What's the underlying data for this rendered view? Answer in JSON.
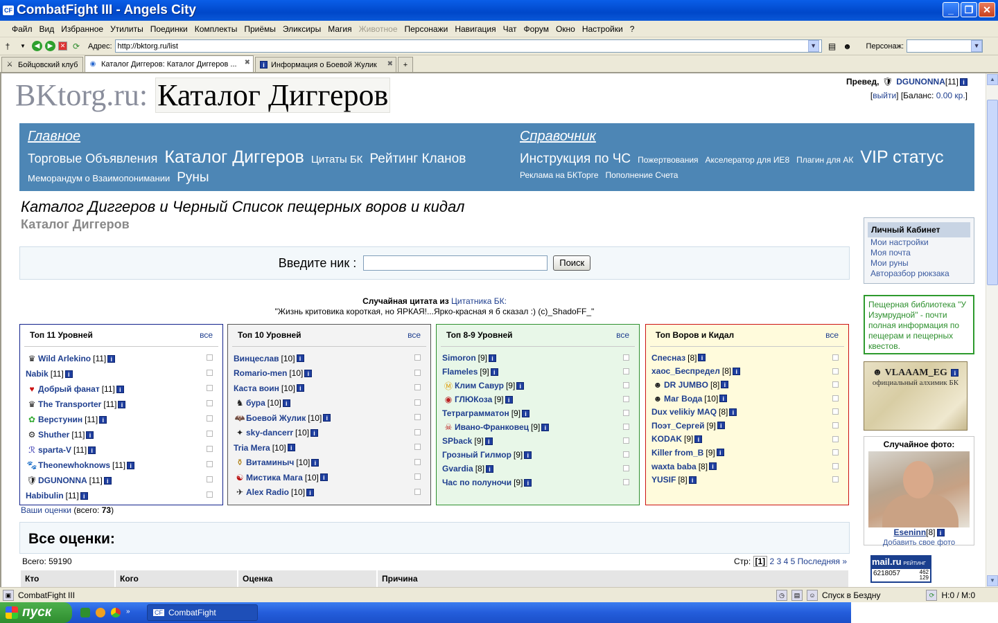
{
  "window": {
    "title": "CombatFight III - Angels City",
    "app_icon": "CF"
  },
  "menu": [
    "Файл",
    "Вид",
    "Избранное",
    "Утилиты",
    "Поединки",
    "Комплекты",
    "Приёмы",
    "Эликсиры",
    "Магия",
    "Животное",
    "Персонажи",
    "Навигация",
    "Чат",
    "Форум",
    "Окно",
    "Настройки",
    "?"
  ],
  "menu_disabled": [
    "Животное"
  ],
  "address": {
    "label": "Адрес:",
    "url": "http://bktorg.ru/list",
    "persona_label": "Персонаж:"
  },
  "tabs": [
    {
      "label": "Бойцовский клуб",
      "icon": "crossed-swords-icon"
    },
    {
      "label": "Каталог Диггеров: Каталог Диггеров ...",
      "icon": "globe-icon"
    },
    {
      "label": "Информация о Боевой Жулик",
      "icon": "info-icon"
    }
  ],
  "site": {
    "logo_left": "BKtorg.ru:",
    "logo_right": "Каталог Диггеров",
    "greeting": "Превед,",
    "user": "DGUNONNA",
    "user_level": "[11]",
    "logout": "выйти",
    "balance_label": "Баланс:",
    "balance": "0.00 кр."
  },
  "nav": {
    "main_head": "Главное",
    "main_row1": [
      "Торговые Объявления",
      "Каталог Диггеров",
      "Цитаты БК",
      "Рейтинг Кланов"
    ],
    "main_row2": [
      "Меморандум о Взаимопонимании",
      "Руны"
    ],
    "ref_head": "Справочник",
    "ref_row1": [
      "Инструкция по ЧС",
      "Пожертвования",
      "Акселератор для ИЕ8",
      "Плагин для АК",
      "VIP статус"
    ],
    "ref_row2": [
      "Реклама на БКТорге",
      "Пополнение Счета"
    ]
  },
  "page": {
    "heading": "Каталог Диггеров и Черный Список пещерных воров и кидал",
    "subheading": "Каталог Диггеров",
    "search_label": "Введите ник :",
    "search_button": "Поиск",
    "quote_title": "Случайная цитата из",
    "quote_source": "Цитатника БК:",
    "quote_text": "\"Жизнь критовика короткая, но ЯРКАЯ!...Ярко-красная я б сказал :) (c)_ShadoFF_\""
  },
  "top_lists": [
    {
      "title": "Топ 11 Уровней",
      "all": "все",
      "items": [
        {
          "name": "Wild Arlekino",
          "level": "[11]",
          "icon": "crown-icon"
        },
        {
          "name": "Nabik",
          "level": "[11]",
          "icon": ""
        },
        {
          "name": "Добрый фанат",
          "level": "[11]",
          "icon": "heart-shield-icon"
        },
        {
          "name": "The Transporter",
          "level": "[11]",
          "icon": "crown-icon"
        },
        {
          "name": "Верстунин",
          "level": "[11]",
          "icon": "leaf-icon"
        },
        {
          "name": "Shuther",
          "level": "[11]",
          "icon": "gear-icon"
        },
        {
          "name": "sparta-V",
          "level": "[11]",
          "icon": "rune-icon"
        },
        {
          "name": "Theonewhoknows",
          "level": "[11]",
          "icon": "panther-icon"
        },
        {
          "name": "DGUNONNA",
          "level": "[11]",
          "icon": "clan-icon"
        },
        {
          "name": "Habibulin",
          "level": "[11]",
          "icon": ""
        }
      ]
    },
    {
      "title": "Топ 10 Уровней",
      "all": "все",
      "items": [
        {
          "name": "Винцеслав",
          "level": "[10]",
          "icon": ""
        },
        {
          "name": "Romario-men",
          "level": "[10]",
          "icon": ""
        },
        {
          "name": "Каста воин",
          "level": "[10]",
          "icon": ""
        },
        {
          "name": "бура",
          "level": "[10]",
          "icon": "dragon-icon"
        },
        {
          "name": "Боевой Жулик",
          "level": "[10]",
          "icon": "bat-icon"
        },
        {
          "name": "sky-dancerr",
          "level": "[10]",
          "icon": "star-icon"
        },
        {
          "name": "Tria Mera",
          "level": "[10]",
          "icon": ""
        },
        {
          "name": "Витаминыч",
          "level": "[10]",
          "icon": "potion-icon"
        },
        {
          "name": "Мистика Мага",
          "level": "[10]",
          "icon": "mask-icon"
        },
        {
          "name": "Alex Radio",
          "level": "[10]",
          "icon": "bird-icon"
        }
      ]
    },
    {
      "title": "Топ 8-9 Уровней",
      "all": "все",
      "items": [
        {
          "name": "Simoron",
          "level": "[9]",
          "icon": ""
        },
        {
          "name": "Flameles",
          "level": "[9]",
          "icon": ""
        },
        {
          "name": "Клим Савур",
          "level": "[9]",
          "icon": "mk-icon"
        },
        {
          "name": "ГЛЮКоза",
          "level": "[9]",
          "icon": "eye-icon"
        },
        {
          "name": "Тетраграмматон",
          "level": "[9]",
          "icon": ""
        },
        {
          "name": "Ивано-Франковец",
          "level": "[9]",
          "icon": "skull-icon"
        },
        {
          "name": "SPback",
          "level": "[9]",
          "icon": ""
        },
        {
          "name": "Грозный Гилмор",
          "level": "[9]",
          "icon": ""
        },
        {
          "name": "Gvardia",
          "level": "[8]",
          "icon": ""
        },
        {
          "name": "Час по полуночи",
          "level": "[9]",
          "icon": ""
        }
      ]
    },
    {
      "title": "Топ Воров и Кидал",
      "all": "все",
      "items": [
        {
          "name": "Спесназ",
          "level": "[8]",
          "icon": ""
        },
        {
          "name": "хаос_Беспредел",
          "level": "[8]",
          "icon": ""
        },
        {
          "name": "DR JUMBO",
          "level": "[8]",
          "icon": "ghost-icon"
        },
        {
          "name": "Маг Вода",
          "level": "[10]",
          "icon": "ghost-icon"
        },
        {
          "name": "Dux velikiy MAQ",
          "level": "[8]",
          "icon": ""
        },
        {
          "name": "Поэт_Сергей",
          "level": "[9]",
          "icon": ""
        },
        {
          "name": "KODAK",
          "level": "[9]",
          "icon": ""
        },
        {
          "name": "Killer from_B",
          "level": "[9]",
          "icon": ""
        },
        {
          "name": "waxta baba",
          "level": "[8]",
          "icon": ""
        },
        {
          "name": "YUSIF",
          "level": "[8]",
          "icon": ""
        }
      ]
    }
  ],
  "votes": {
    "link": "Ваши оценки",
    "total_label": "(всего:",
    "total": "73",
    "close": ")"
  },
  "all_votes": {
    "title": "Все оценки:",
    "total": "Всего: 59190",
    "pages_label": "Стр:",
    "current": "[1]",
    "pages": [
      "2",
      "3",
      "4",
      "5"
    ],
    "last": "Последняя »",
    "columns": [
      "Кто",
      "Кого",
      "Оценка",
      "Причина"
    ]
  },
  "sidebar": {
    "cabinet_title": "Личный Кабинет",
    "cabinet_links": [
      "Мои настройки",
      "Моя почта",
      "Мои руны",
      "Авторазбор рюкзака"
    ],
    "library_text": "Пещерная библиотека \"У Изумрудной\" - почти полная информация по пещерам и пещерных квестов.",
    "banner_name": "VLAAAM_EG",
    "banner_sub": "официальный алхимик БК",
    "photo_title": "Случайное фото:",
    "photo_user": "Eseninn",
    "photo_level": "[8]",
    "photo_add": "Добавить свое фото",
    "counter_logo": "mail.ru",
    "counter_tag": "РЕЙТИНГ",
    "counter_value": "6218057",
    "counter_small1": "462",
    "counter_small2": "129"
  },
  "status": {
    "left": "CombatFight III",
    "zone": "Спуск в Бездну",
    "hm": "H:0 / M:0"
  },
  "taskbar": {
    "start": "пуск",
    "item": "CombatFight"
  }
}
